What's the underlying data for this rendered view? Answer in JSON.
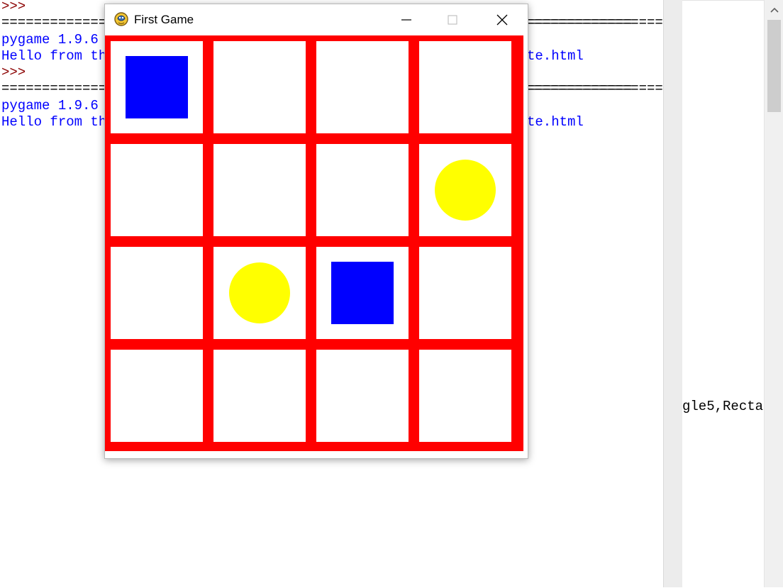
{
  "shell": {
    "lines": [
      {
        "text": ">>>",
        "kind": "prompt"
      },
      {
        "text": "==============================================================================",
        "kind": "rule"
      },
      {
        "text": "pygame 1.9.6",
        "kind": "out"
      },
      {
        "text": "Hello from th",
        "kind": "out"
      },
      {
        "text": ">>>",
        "kind": "prompt"
      },
      {
        "text": "==============================================================================",
        "kind": "rule"
      },
      {
        "text": "pygame 1.9.6",
        "kind": "out"
      },
      {
        "text": "Hello from th",
        "kind": "out"
      }
    ],
    "right_fragments": {
      "line4": "te.html",
      "line8": "te.html"
    }
  },
  "editor": {
    "visible_text": "gle5,Recta"
  },
  "window": {
    "title": "First Game",
    "icon": "pygame-snake-icon",
    "buttons": [
      "minimize-icon",
      "maximize-icon",
      "close-icon"
    ]
  },
  "game": {
    "grid_rows": 4,
    "grid_cols": 4,
    "colors": {
      "grid": "#ff0000",
      "cell": "#ffffff",
      "square": "#0000ff",
      "circle": "#ffff00"
    },
    "pieces": [
      {
        "shape": "square",
        "row": 0,
        "col": 0
      },
      {
        "shape": "circle",
        "row": 1,
        "col": 3
      },
      {
        "shape": "circle",
        "row": 2,
        "col": 1
      },
      {
        "shape": "square",
        "row": 2,
        "col": 2
      }
    ]
  }
}
